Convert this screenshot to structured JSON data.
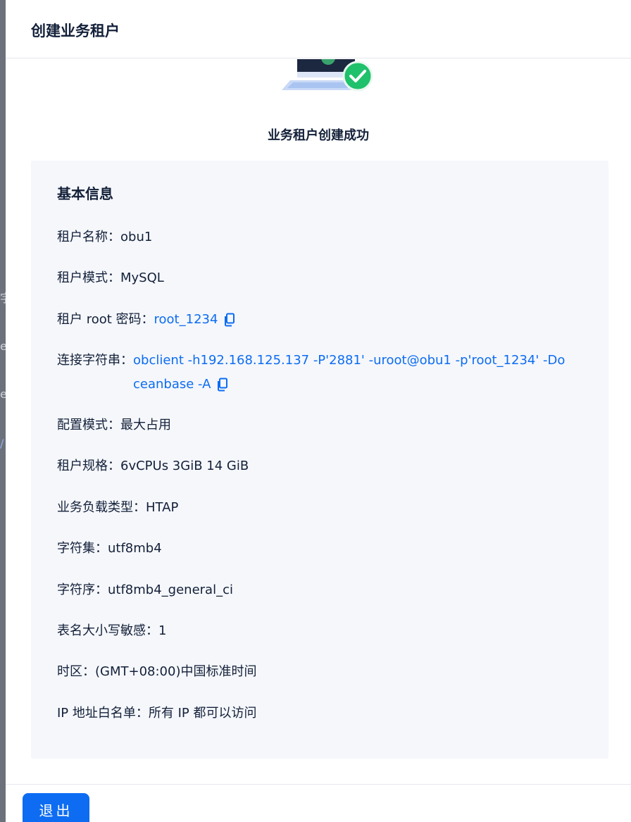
{
  "drawer": {
    "title": "创建业务租户"
  },
  "result": {
    "title": "业务租户创建成功",
    "icon": "success-check-icon",
    "accent_color": "#0d6cf2",
    "success_color": "#1fc16b"
  },
  "info": {
    "title": "基本信息",
    "rows": [
      {
        "label": "租户名称：",
        "value": "obu1"
      },
      {
        "label": "租户模式：",
        "value": "MySQL"
      },
      {
        "label": "租户 root 密码：",
        "value": "root_1234"
      },
      {
        "label": "连接字符串：",
        "value": "obclient -h192.168.125.137 -P'2881' -uroot@obu1 -p'root_1234' -Doceanbase -A"
      },
      {
        "label": "配置模式：",
        "value": "最大占用"
      },
      {
        "label": "租户规格：",
        "value": "6vCPUs 3GiB 14 GiB"
      },
      {
        "label": "业务负载类型：",
        "value": "HTAP"
      },
      {
        "label": "字符集：",
        "value": "utf8mb4"
      },
      {
        "label": "字符序：",
        "value": "utf8mb4_general_ci"
      },
      {
        "label": "表名大小写敏感：",
        "value": "1"
      },
      {
        "label": "时区：",
        "value": "(GMT+08:00)中国标准时间"
      },
      {
        "label": "IP 地址白名单：",
        "value": "所有 IP 都可以访问"
      }
    ]
  },
  "footer": {
    "exit_label": "退出"
  },
  "background": {
    "fragments": [
      "字",
      "er",
      "er",
      "/"
    ]
  }
}
